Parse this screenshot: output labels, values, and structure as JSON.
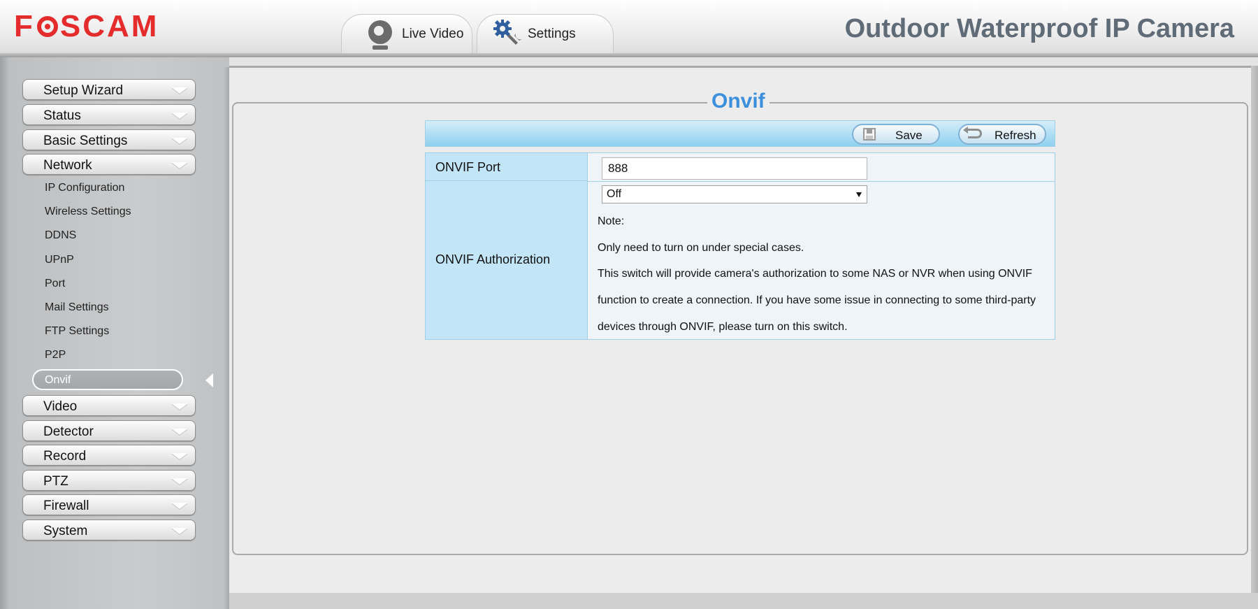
{
  "header": {
    "logo_text": "FOSCAM",
    "product_title": "Outdoor Waterproof IP Camera",
    "tabs": [
      {
        "label": "Live Video",
        "icon": "webcam-icon"
      },
      {
        "label": "Settings",
        "icon": "gears-icon"
      }
    ]
  },
  "sidebar": {
    "menus": [
      {
        "label": "Setup Wizard"
      },
      {
        "label": "Status"
      },
      {
        "label": "Basic Settings"
      },
      {
        "label": "Network"
      },
      {
        "label": "Video"
      },
      {
        "label": "Detector"
      },
      {
        "label": "Record"
      },
      {
        "label": "PTZ"
      },
      {
        "label": "Firewall"
      },
      {
        "label": "System"
      }
    ],
    "network_submenu": [
      "IP Configuration",
      "Wireless Settings",
      "DDNS",
      "UPnP",
      "Port",
      "Mail Settings",
      "FTP Settings",
      "P2P",
      "Onvif"
    ],
    "active_item": "Onvif"
  },
  "main": {
    "title": "Onvif",
    "toolbar": {
      "save_label": "Save",
      "refresh_label": "Refresh"
    },
    "form": {
      "port_label": "ONVIF Port",
      "port_value": "888",
      "auth_label": "ONVIF Authorization",
      "auth_value": "Off",
      "note_lines": [
        "Note:",
        "Only need to turn on under special cases.",
        "This switch will provide camera's authorization to some NAS or NVR when using ONVIF",
        "function to create a connection. If you have some issue in connecting to some third-party",
        "devices through ONVIF, please turn on this switch."
      ]
    }
  },
  "colors": {
    "brand": "#e42c2c",
    "title_blue": "#3c8fdb",
    "label_cell": "#c2e5f8",
    "toolbar_blue": "#8fd0ee",
    "product_title_gray": "#5f6b76"
  }
}
